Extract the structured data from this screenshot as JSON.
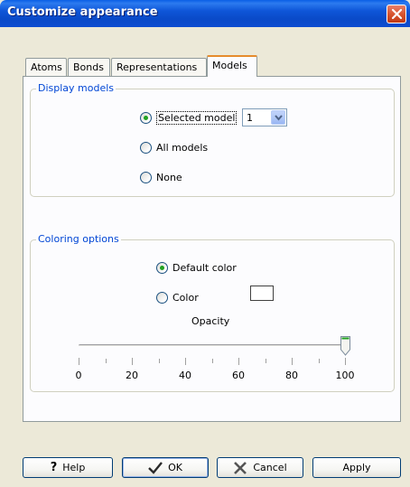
{
  "window": {
    "title": "Customize appearance",
    "close_icon": "close-icon"
  },
  "tabs": [
    {
      "label": "Atoms",
      "active": false
    },
    {
      "label": "Bonds",
      "active": false
    },
    {
      "label": "Representations",
      "active": false
    },
    {
      "label": "Models",
      "active": true
    }
  ],
  "display_models": {
    "legend": "Display models",
    "options": [
      {
        "label": "Selected model",
        "checked": true
      },
      {
        "label": "All models",
        "checked": false
      },
      {
        "label": "None",
        "checked": false
      }
    ],
    "model_select": {
      "value": "1"
    }
  },
  "coloring_options": {
    "legend": "Coloring options",
    "options": [
      {
        "label": "Default color",
        "checked": true
      },
      {
        "label": "Color",
        "checked": false
      }
    ],
    "swatch_color": "#FFFFFF",
    "opacity": {
      "label": "Opacity",
      "value": 100,
      "min": 0,
      "max": 100,
      "tick_labels": [
        "0",
        "20",
        "40",
        "60",
        "80",
        "100"
      ]
    }
  },
  "buttons": {
    "help": "Help",
    "ok": "OK",
    "cancel": "Cancel",
    "apply": "Apply"
  },
  "colors": {
    "titlebar": "#0A4AC8",
    "accent_tab": "#E68B2C",
    "legend_text": "#0046D5",
    "radio_checked": "#21A121"
  }
}
